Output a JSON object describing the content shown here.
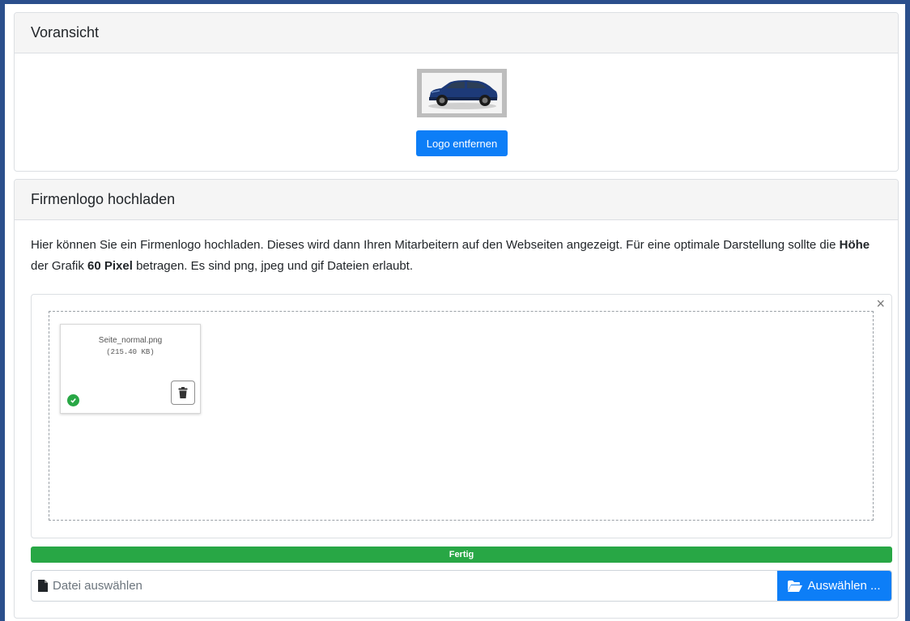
{
  "preview": {
    "title": "Voransicht",
    "remove_button": "Logo entfernen"
  },
  "upload": {
    "title": "Firmenlogo hochladen",
    "description_part1": "Hier können Sie ein Firmenlogo hochladen. Dieses wird dann Ihren Mitarbeitern auf den Webseiten angezeigt. Für eine optimale Darstellung sollte die ",
    "description_bold1": "Höhe",
    "description_part2": " der Grafik ",
    "description_bold2": "60 Pixel",
    "description_part3": " betragen. Es sind png, jpeg und gif Dateien erlaubt.",
    "dropzone": {
      "close_symbol": "×",
      "file": {
        "name": "Seite_normal.png",
        "size": "(215.40 KB)",
        "status_icon": "check-circle-icon",
        "delete_icon": "trash-icon"
      }
    },
    "progress": {
      "label": "Fertig",
      "percent": 100
    },
    "file_input": {
      "placeholder": "Datei auswählen",
      "button_label": "Auswählen ...",
      "field_icon": "file-icon",
      "button_icon": "folder-open-icon"
    }
  },
  "colors": {
    "frame": "#2b4f8c",
    "primary": "#0d7ef7",
    "success": "#28a745"
  }
}
